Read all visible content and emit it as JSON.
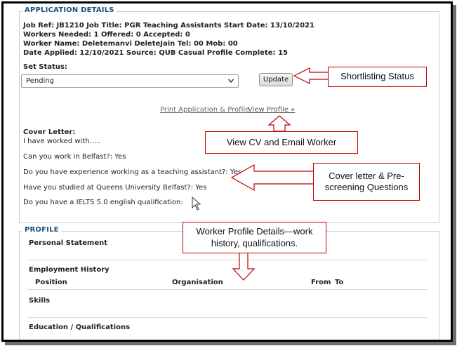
{
  "application": {
    "legend": "APPLICATION DETAILS",
    "line1": "Job Ref: JB1210 Job Title: PGR Teaching Assistants Start Date: 13/10/2021",
    "line2": "Workers Needed: 1 Offered: 0 Accepted: 0",
    "line3": "Worker Name: Deletemanvi DeleteJain Tel: 00 Mob: 00",
    "line4": "Date Applied: 12/10/2021 Source: QUB Casual Profile Complete: 15",
    "set_status_label": "Set Status:",
    "status_value": "Pending",
    "update_label": "Update",
    "print_link": "Print Application & Profile",
    "view_profile_link": "View Profile »"
  },
  "cover_letter": {
    "heading": "Cover Letter:",
    "text": "I have worked with.....",
    "q1": "Can you work in Belfast?: Yes",
    "q2": "Do you have experience working as a teaching assistant?: Yes",
    "q3": "Have you studied at Queens University Belfast?: Yes",
    "q4": "Do you have a IELTS 5.0 english qualification:"
  },
  "profile": {
    "legend": "PROFILE",
    "personal_statement": "Personal Statement",
    "employment_history": "Employment History",
    "col_position": "Position",
    "col_organisation": "Organisation",
    "col_from": "From",
    "col_to": "To",
    "skills": "Skills",
    "education": "Education / Qualifications"
  },
  "callouts": {
    "shortlisting": "Shortlisting Status",
    "view_cv": "View CV and Email Worker",
    "cover_letter": "Cover letter & Pre-screening Questions",
    "worker_profile": "Worker Profile Details—work history, qualifications."
  },
  "colors": {
    "legend": "#1d4f7a",
    "callout_border": "#c00000",
    "link": "#6a6a6a",
    "link_active": "#555555"
  }
}
